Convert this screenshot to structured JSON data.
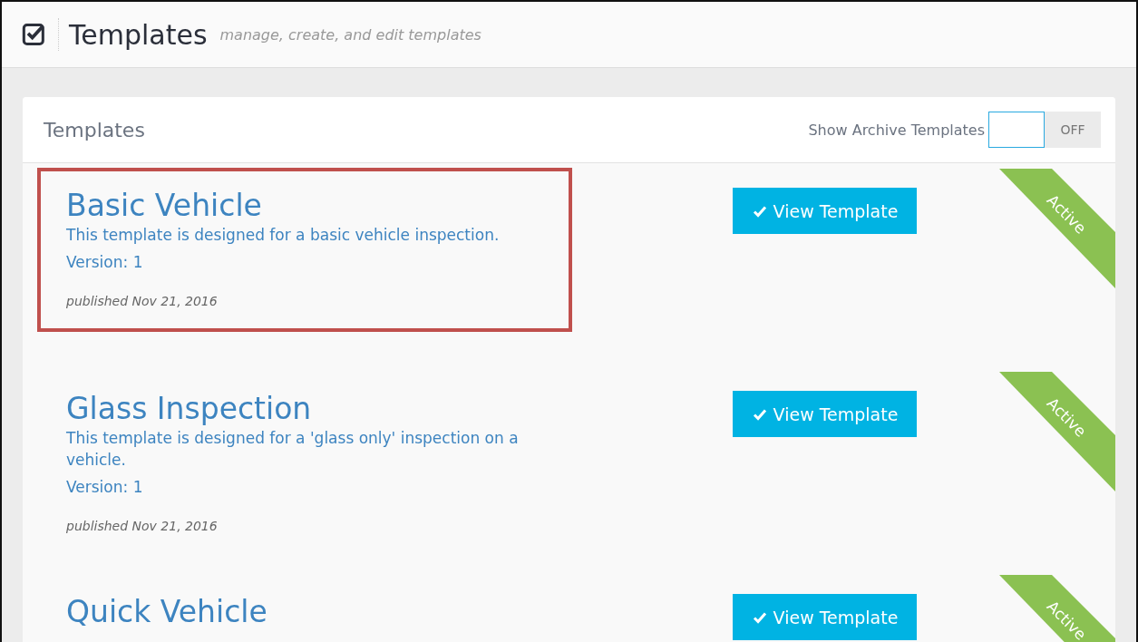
{
  "page_header": {
    "title": "Templates",
    "subtitle": "manage, create, and edit templates"
  },
  "panel": {
    "title": "Templates",
    "archive_toggle": {
      "label": "Show Archive Templates",
      "on": false,
      "state_text": "OFF"
    }
  },
  "templates": [
    {
      "name": "Basic Vehicle",
      "description": "This template is designed for a basic vehicle inspection.",
      "version": "Version: 1",
      "published": "published Nov 21, 2016",
      "button": "View Template",
      "ribbon": "Active",
      "highlighted": true
    },
    {
      "name": "Glass Inspection",
      "description": "This template is designed for a 'glass only' inspection on a vehicle.",
      "version": "Version: 1",
      "published": "published Nov 21, 2016",
      "button": "View Template",
      "ribbon": "Active",
      "highlighted": false
    },
    {
      "name": "Quick Vehicle",
      "button": "View Template",
      "ribbon": "Active",
      "highlighted": false
    }
  ]
}
